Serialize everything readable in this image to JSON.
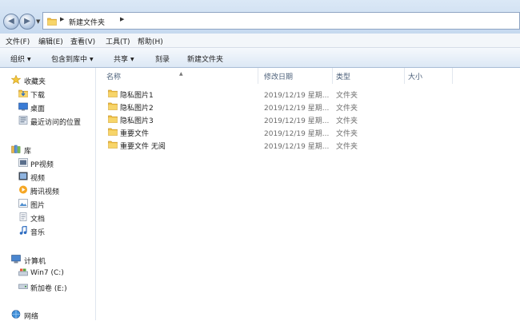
{
  "address": {
    "path": "新建文件夹"
  },
  "menu": {
    "file": "文件(F)",
    "edit": "编辑(E)",
    "view": "查看(V)",
    "tools": "工具(T)",
    "help": "帮助(H)"
  },
  "toolbar": {
    "organize": "组织",
    "include": "包含到库中",
    "share": "共享",
    "burn": "刻录",
    "new_folder": "新建文件夹"
  },
  "sidebar": {
    "favorites": {
      "label": "收藏夹",
      "items": [
        {
          "label": "下载",
          "icon": "download-folder-icon"
        },
        {
          "label": "桌面",
          "icon": "desktop-icon"
        },
        {
          "label": "最近访问的位置",
          "icon": "recent-places-icon"
        }
      ]
    },
    "libraries": {
      "label": "库",
      "items": [
        {
          "label": "PP视频",
          "icon": "pp-video-icon"
        },
        {
          "label": "视频",
          "icon": "video-library-icon"
        },
        {
          "label": "腾讯视频",
          "icon": "tencent-video-icon"
        },
        {
          "label": "图片",
          "icon": "pictures-library-icon"
        },
        {
          "label": "文档",
          "icon": "documents-library-icon"
        },
        {
          "label": "音乐",
          "icon": "music-library-icon"
        }
      ]
    },
    "computer": {
      "label": "计算机",
      "items": [
        {
          "label": "Win7 (C:)",
          "icon": "system-drive-icon"
        },
        {
          "label": "新加卷 (E:)",
          "icon": "drive-icon"
        }
      ]
    },
    "network": {
      "label": "网络"
    }
  },
  "columns": {
    "name": "名称",
    "modified": "修改日期",
    "type": "类型",
    "size": "大小"
  },
  "files": [
    {
      "name": "隐私图片1",
      "modified": "2019/12/19 星期...",
      "type": "文件夹"
    },
    {
      "name": "隐私图片2",
      "modified": "2019/12/19 星期...",
      "type": "文件夹"
    },
    {
      "name": "隐私图片3",
      "modified": "2019/12/19 星期...",
      "type": "文件夹"
    },
    {
      "name": "重要文件",
      "modified": "2019/12/19 星期...",
      "type": "文件夹"
    },
    {
      "name": "重要文件 无阅",
      "modified": "2019/12/19 星期...",
      "type": "文件夹"
    }
  ],
  "colors": {
    "folder": "#f0c040",
    "chrome": "#dbe8f6",
    "accent": "#1e4e8c"
  }
}
